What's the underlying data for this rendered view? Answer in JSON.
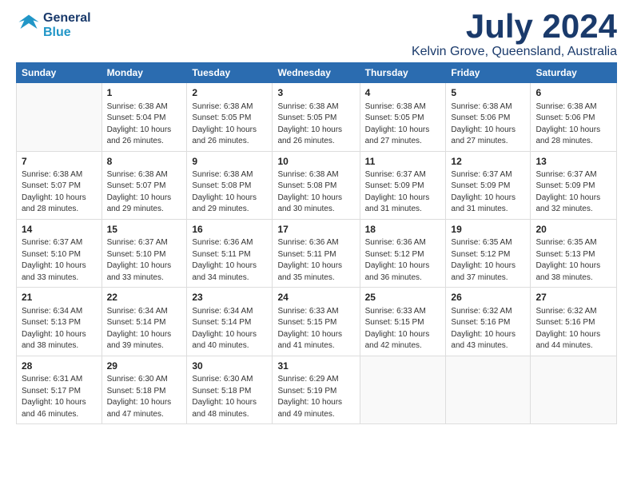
{
  "header": {
    "logo_line1": "General",
    "logo_line2": "Blue",
    "month": "July 2024",
    "location": "Kelvin Grove, Queensland, Australia"
  },
  "weekdays": [
    "Sunday",
    "Monday",
    "Tuesday",
    "Wednesday",
    "Thursday",
    "Friday",
    "Saturday"
  ],
  "weeks": [
    [
      {
        "day": "",
        "info": ""
      },
      {
        "day": "1",
        "info": "Sunrise: 6:38 AM\nSunset: 5:04 PM\nDaylight: 10 hours\nand 26 minutes."
      },
      {
        "day": "2",
        "info": "Sunrise: 6:38 AM\nSunset: 5:05 PM\nDaylight: 10 hours\nand 26 minutes."
      },
      {
        "day": "3",
        "info": "Sunrise: 6:38 AM\nSunset: 5:05 PM\nDaylight: 10 hours\nand 26 minutes."
      },
      {
        "day": "4",
        "info": "Sunrise: 6:38 AM\nSunset: 5:05 PM\nDaylight: 10 hours\nand 27 minutes."
      },
      {
        "day": "5",
        "info": "Sunrise: 6:38 AM\nSunset: 5:06 PM\nDaylight: 10 hours\nand 27 minutes."
      },
      {
        "day": "6",
        "info": "Sunrise: 6:38 AM\nSunset: 5:06 PM\nDaylight: 10 hours\nand 28 minutes."
      }
    ],
    [
      {
        "day": "7",
        "info": "Sunrise: 6:38 AM\nSunset: 5:07 PM\nDaylight: 10 hours\nand 28 minutes."
      },
      {
        "day": "8",
        "info": "Sunrise: 6:38 AM\nSunset: 5:07 PM\nDaylight: 10 hours\nand 29 minutes."
      },
      {
        "day": "9",
        "info": "Sunrise: 6:38 AM\nSunset: 5:08 PM\nDaylight: 10 hours\nand 29 minutes."
      },
      {
        "day": "10",
        "info": "Sunrise: 6:38 AM\nSunset: 5:08 PM\nDaylight: 10 hours\nand 30 minutes."
      },
      {
        "day": "11",
        "info": "Sunrise: 6:37 AM\nSunset: 5:09 PM\nDaylight: 10 hours\nand 31 minutes."
      },
      {
        "day": "12",
        "info": "Sunrise: 6:37 AM\nSunset: 5:09 PM\nDaylight: 10 hours\nand 31 minutes."
      },
      {
        "day": "13",
        "info": "Sunrise: 6:37 AM\nSunset: 5:09 PM\nDaylight: 10 hours\nand 32 minutes."
      }
    ],
    [
      {
        "day": "14",
        "info": "Sunrise: 6:37 AM\nSunset: 5:10 PM\nDaylight: 10 hours\nand 33 minutes."
      },
      {
        "day": "15",
        "info": "Sunrise: 6:37 AM\nSunset: 5:10 PM\nDaylight: 10 hours\nand 33 minutes."
      },
      {
        "day": "16",
        "info": "Sunrise: 6:36 AM\nSunset: 5:11 PM\nDaylight: 10 hours\nand 34 minutes."
      },
      {
        "day": "17",
        "info": "Sunrise: 6:36 AM\nSunset: 5:11 PM\nDaylight: 10 hours\nand 35 minutes."
      },
      {
        "day": "18",
        "info": "Sunrise: 6:36 AM\nSunset: 5:12 PM\nDaylight: 10 hours\nand 36 minutes."
      },
      {
        "day": "19",
        "info": "Sunrise: 6:35 AM\nSunset: 5:12 PM\nDaylight: 10 hours\nand 37 minutes."
      },
      {
        "day": "20",
        "info": "Sunrise: 6:35 AM\nSunset: 5:13 PM\nDaylight: 10 hours\nand 38 minutes."
      }
    ],
    [
      {
        "day": "21",
        "info": "Sunrise: 6:34 AM\nSunset: 5:13 PM\nDaylight: 10 hours\nand 38 minutes."
      },
      {
        "day": "22",
        "info": "Sunrise: 6:34 AM\nSunset: 5:14 PM\nDaylight: 10 hours\nand 39 minutes."
      },
      {
        "day": "23",
        "info": "Sunrise: 6:34 AM\nSunset: 5:14 PM\nDaylight: 10 hours\nand 40 minutes."
      },
      {
        "day": "24",
        "info": "Sunrise: 6:33 AM\nSunset: 5:15 PM\nDaylight: 10 hours\nand 41 minutes."
      },
      {
        "day": "25",
        "info": "Sunrise: 6:33 AM\nSunset: 5:15 PM\nDaylight: 10 hours\nand 42 minutes."
      },
      {
        "day": "26",
        "info": "Sunrise: 6:32 AM\nSunset: 5:16 PM\nDaylight: 10 hours\nand 43 minutes."
      },
      {
        "day": "27",
        "info": "Sunrise: 6:32 AM\nSunset: 5:16 PM\nDaylight: 10 hours\nand 44 minutes."
      }
    ],
    [
      {
        "day": "28",
        "info": "Sunrise: 6:31 AM\nSunset: 5:17 PM\nDaylight: 10 hours\nand 46 minutes."
      },
      {
        "day": "29",
        "info": "Sunrise: 6:30 AM\nSunset: 5:18 PM\nDaylight: 10 hours\nand 47 minutes."
      },
      {
        "day": "30",
        "info": "Sunrise: 6:30 AM\nSunset: 5:18 PM\nDaylight: 10 hours\nand 48 minutes."
      },
      {
        "day": "31",
        "info": "Sunrise: 6:29 AM\nSunset: 5:19 PM\nDaylight: 10 hours\nand 49 minutes."
      },
      {
        "day": "",
        "info": ""
      },
      {
        "day": "",
        "info": ""
      },
      {
        "day": "",
        "info": ""
      }
    ]
  ]
}
